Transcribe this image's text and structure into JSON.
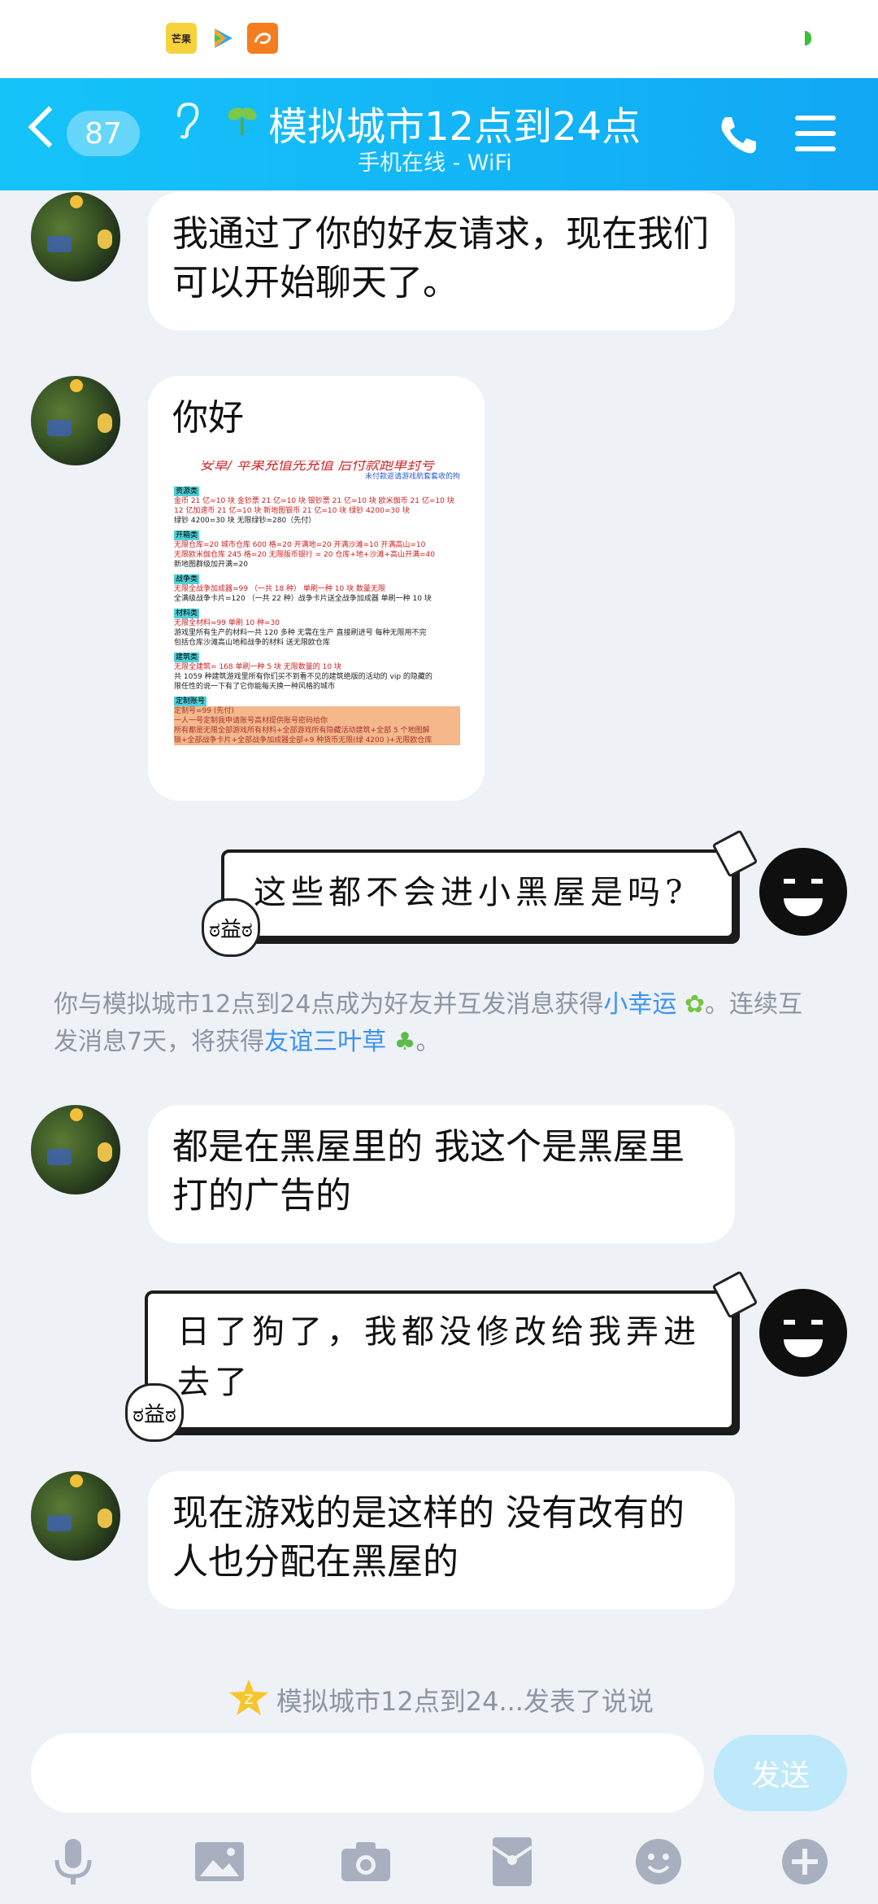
{
  "status_bar": {
    "app_icons": [
      "mango-tv-icon",
      "tencent-video-icon",
      "uc-browser-icon"
    ],
    "mango_label": "芒果"
  },
  "header": {
    "unread_count": "87",
    "title": "模拟城市12点到24点",
    "subtitle": "手机在线 - WiFi",
    "accent_color": "#13b4f6"
  },
  "messages": [
    {
      "side": "left",
      "text": "我通过了你的好友请求，现在我们可以开始聊天了。"
    },
    {
      "side": "left",
      "text": "你好",
      "poster": {
        "title": "安卓/ 苹果充值先充值  后付款跑单封号",
        "subtitle": "未付款返请游戏航套套收的拘",
        "section_resources": "资源类",
        "line_1": "金币 21 亿=10 块  金钞票 21 亿=10 块  银钞票 21 亿=10 块  欧米伽币 21 亿=10 块",
        "line_2": "12 亿加速币 21 亿=10 块    新地图银币 21 亿=10 块      绿钞 4200=30 块",
        "line_3": "绿钞 4200=30 块   无限绿钞=280（先付）",
        "section_open": "开箱类",
        "line_4": "无限仓库=20     城市仓库 600 格=20   开满地=20   开满沙滩=10   开满高山=10",
        "line_5": "无限欧米伽仓库 245 格=20    无限版币银行 = 20   仓库+地+沙滩+高山开满=40",
        "line_6": "新地图群级加开满=20",
        "section_war": "战争类",
        "line_7": "无限全战争加成器=99      （一共 18 种）     单刷一种 10 块   数量无限",
        "line_8": "全满级战争卡片=120 （一共 22 种）战争卡片送全战争加成器  单刷一种 10 块",
        "section_material": "材料类",
        "line_9": "无限全材料=99      单刷 10 种=30",
        "line_10": "游戏里所有生产的材料一共 120 多种  无需在生产 直接刷进号  每种无限用不完",
        "line_11": "包括仓库沙滩高山地和战争的材料  送无限欧仓库",
        "section_build": "建筑类",
        "line_12": "无限全建筑= 168     单刷一种 5 块   无限数量的 10 块",
        "line_13": "共 1059 种建筑游戏里所有你们买不到看不见的建筑绝版的活动的 vip 的隐藏的",
        "line_14": "限任性的说一下有了它你能每天换一种风格的城市",
        "section_custom": "定制账号",
        "line_15": "定制号=99 (先付)",
        "line_16": "一人一号定制我申请账号高材提供账号密码给你",
        "line_17": "所有都是无限全部游戏所有材料+全部游戏所有隐藏活动建筑+全部 5 个地图解",
        "line_18": "锁+全部战争卡片+全部战争加成器全部+9 种货币无限(绿 4200 )+无限欧仓库"
      }
    },
    {
      "side": "right",
      "style": "sketch",
      "text": "这些都不会进小黑屋是吗?"
    },
    {
      "side": "left",
      "text": "都是在黑屋里的 我这个是黑屋里打的广告的"
    },
    {
      "side": "right",
      "style": "sketch",
      "text": "日了狗了，我都没修改给我弄进去了"
    },
    {
      "side": "left",
      "text": "现在游戏的是这样的 没有改有的人也分配在黑屋的"
    }
  ],
  "system_notice": {
    "part1": "你与模拟城市12点到24点成为好友并互发消息获得",
    "link1": "小幸运",
    "part2": "。连续互发消息7天，将获得",
    "link2": "友谊三叶草",
    "part3": "。"
  },
  "qzone_notice": "模拟城市12点到24...发表了说说",
  "input": {
    "value": "",
    "placeholder": ""
  },
  "send_label": "发送",
  "toolbar": [
    "microphone-icon",
    "image-icon",
    "camera-icon",
    "red-packet-icon",
    "emoji-icon",
    "plus-icon"
  ]
}
